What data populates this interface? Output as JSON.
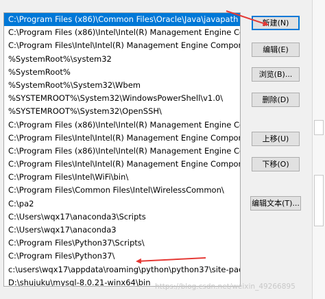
{
  "list": {
    "items": [
      "C:\\Program Files (x86)\\Common Files\\Oracle\\Java\\javapath",
      "C:\\Program Files (x86)\\Intel\\Intel(R) Management Engine Comp...",
      "C:\\Program Files\\Intel\\Intel(R) Management Engine Component...",
      "%SystemRoot%\\system32",
      "%SystemRoot%",
      "%SystemRoot%\\System32\\Wbem",
      "%SYSTEMROOT%\\System32\\WindowsPowerShell\\v1.0\\",
      "%SYSTEMROOT%\\System32\\OpenSSH\\",
      "C:\\Program Files (x86)\\Intel\\Intel(R) Management Engine Comp...",
      "C:\\Program Files\\Intel\\Intel(R) Management Engine Component...",
      "C:\\Program Files (x86)\\Intel\\Intel(R) Management Engine Comp...",
      "C:\\Program Files\\Intel\\Intel(R) Management Engine Component...",
      "C:\\Program Files\\Intel\\WiFi\\bin\\",
      "C:\\Program Files\\Common Files\\Intel\\WirelessCommon\\",
      "C:\\pa2",
      "C:\\Users\\wqx17\\anaconda3\\Scripts",
      "C:\\Users\\wqx17\\anaconda3",
      "C:\\Program Files\\Python37\\Scripts\\",
      "C:\\Program Files\\Python37\\",
      "c:\\users\\wqx17\\appdata\\roaming\\python\\python37\\site-packa...",
      "D:\\shujuku\\mysql-8.0.21-winx64\\bin"
    ],
    "selected_index": 0
  },
  "buttons": {
    "new": "新建(N)",
    "edit": "编辑(E)",
    "browse": "浏览(B)...",
    "delete": "删除(D)",
    "move_up": "上移(U)",
    "move_down": "下移(O)",
    "edit_text": "编辑文本(T)..."
  },
  "watermark": "https://blog.csdn.net/weixin_49266895",
  "colors": {
    "selection": "#0078d7",
    "annotation_arrow": "#e53935"
  }
}
